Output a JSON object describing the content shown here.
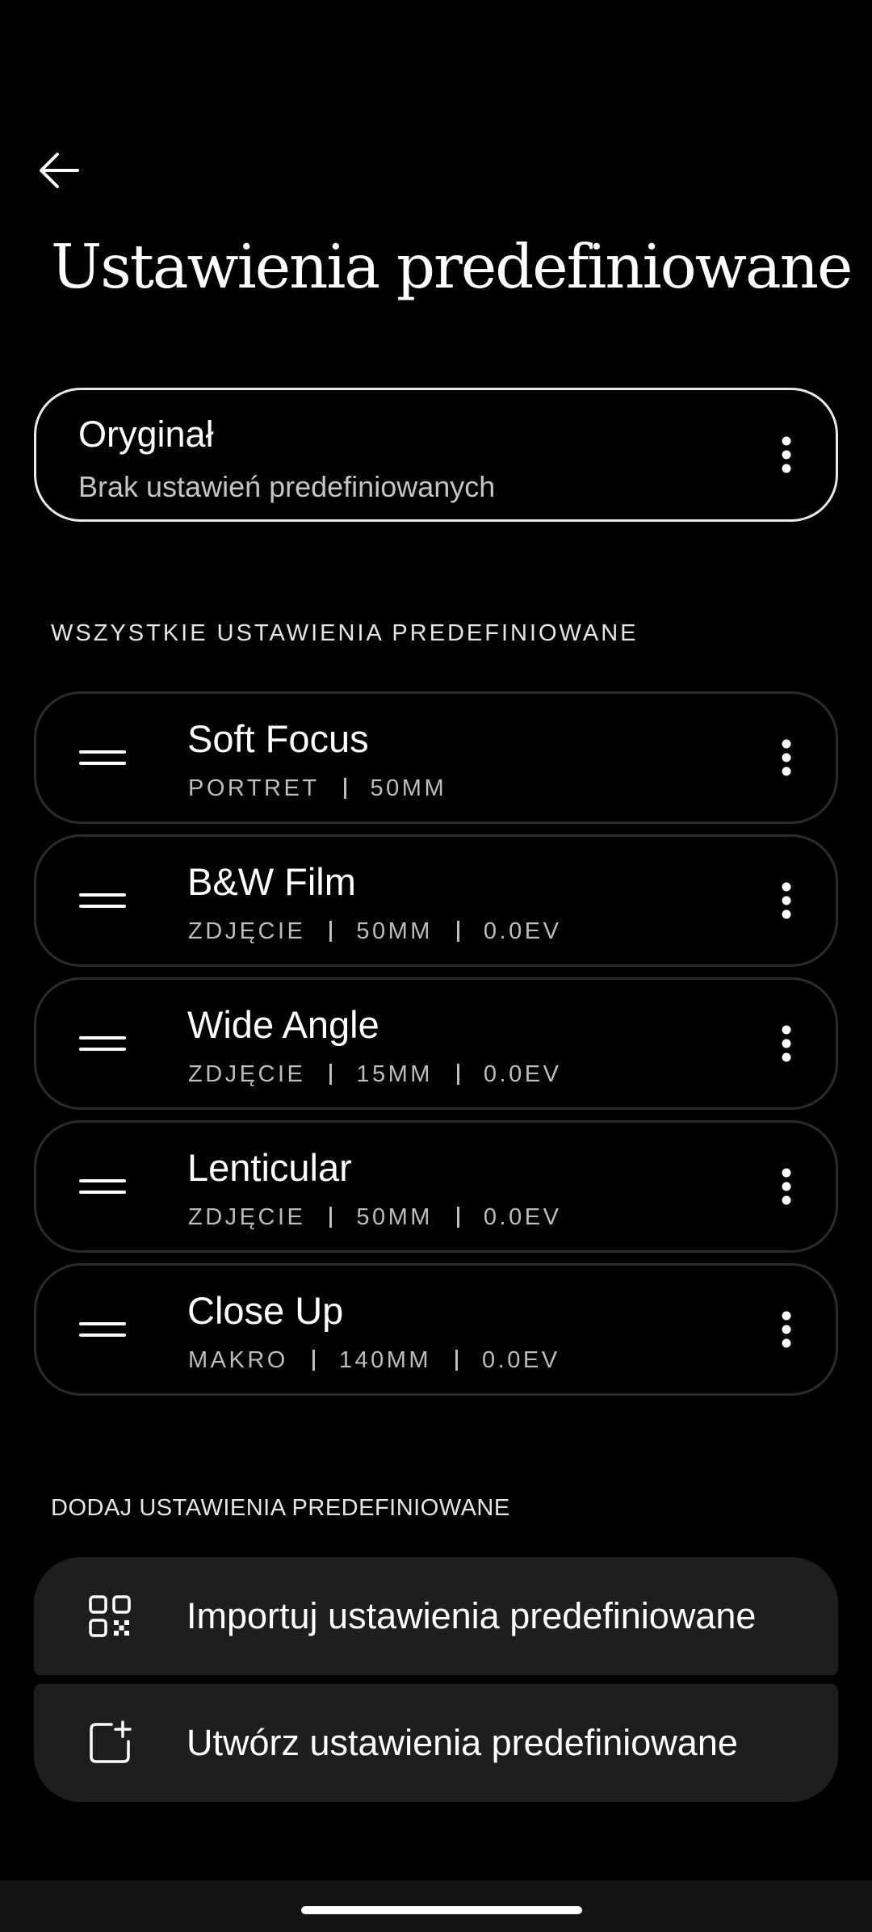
{
  "header": {
    "title": "Ustawienia predefiniowane",
    "back_icon": "arrow-left-icon"
  },
  "original": {
    "title": "Oryginał",
    "subtitle": "Brak ustawień predefiniowanych",
    "menu_icon": "more-vertical-icon"
  },
  "sections": {
    "all_label": "WSZYSTKIE USTAWIENIA PREDEFINIOWANE",
    "add_label": "DODAJ USTAWIENIA PREDEFINIOWANE"
  },
  "presets": [
    {
      "name": "Soft Focus",
      "meta": [
        "PORTRET",
        "50MM"
      ]
    },
    {
      "name": "B&W Film",
      "meta": [
        "ZDJĘCIE",
        "50MM",
        "0.0EV"
      ]
    },
    {
      "name": "Wide Angle",
      "meta": [
        "ZDJĘCIE",
        "15MM",
        "0.0EV"
      ]
    },
    {
      "name": "Lenticular",
      "meta": [
        "ZDJĘCIE",
        "50MM",
        "0.0EV"
      ]
    },
    {
      "name": "Close Up",
      "meta": [
        "MAKRO",
        "140MM",
        "0.0EV"
      ]
    }
  ],
  "actions": {
    "import_label": "Importuj ustawienia predefiniowane",
    "import_icon": "qr-code-icon",
    "create_label": "Utwórz ustawienia predefiniowane",
    "create_icon": "add-box-icon"
  },
  "colors": {
    "background": "#000000",
    "card_border_primary": "#e9e9e9",
    "card_border": "#2c2c2c",
    "action_background": "#1e1e1e",
    "secondary_text": "#bdbdbd"
  }
}
